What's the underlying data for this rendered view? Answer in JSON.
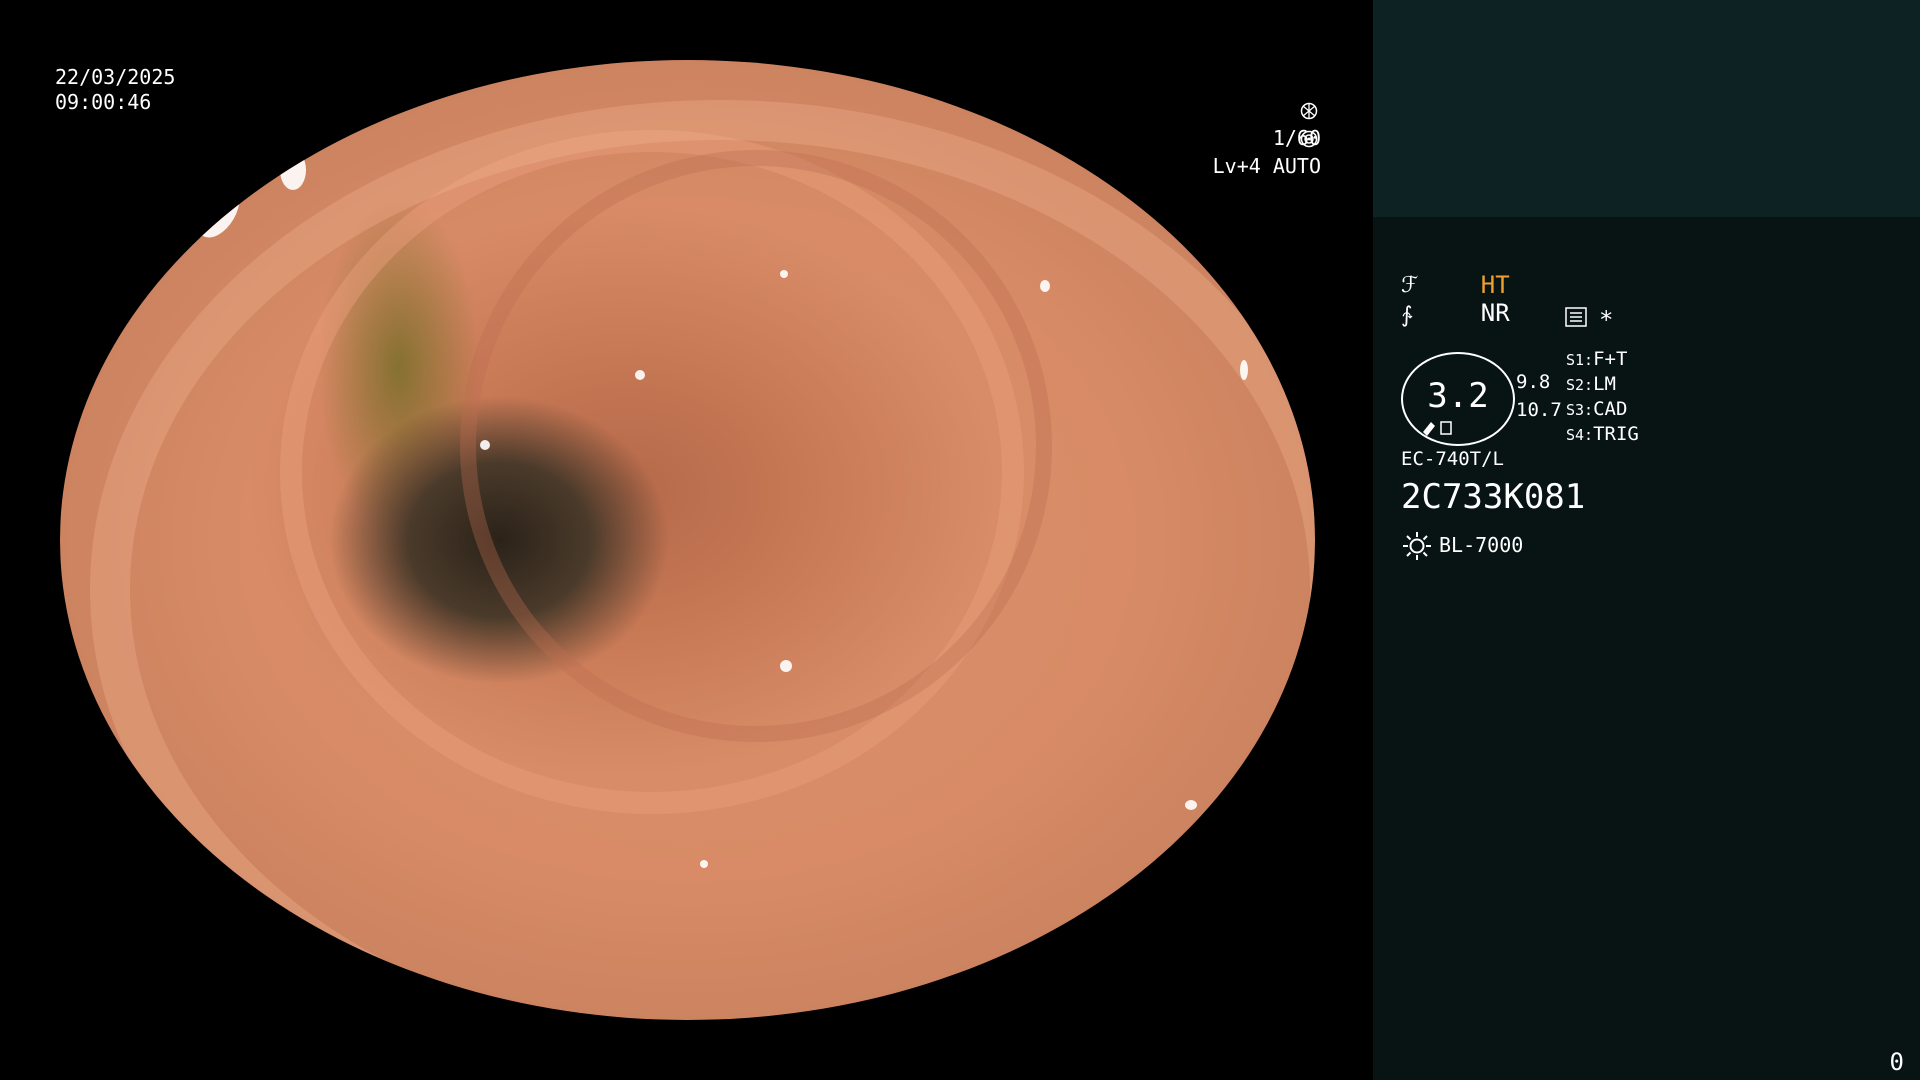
{
  "overlay": {
    "date": "22/03/2025",
    "time": "09:00:46",
    "shutter": "1/60",
    "level": "Lv+4 AUTO"
  },
  "panel": {
    "mode_ht": "HT",
    "mode_nr": "NR",
    "symbol_1": "ℱ",
    "symbol_2": "∱",
    "star": "*",
    "dial_value": "3.2",
    "side_value_1": "9.8",
    "side_value_2": "10.7",
    "switches": [
      {
        "key": "S1:",
        "value": "F+T"
      },
      {
        "key": "S2:",
        "value": "LM"
      },
      {
        "key": "S3:",
        "value": "CAD"
      },
      {
        "key": "S4:",
        "value": "TRIG"
      }
    ],
    "scope_model": "EC-740T/L",
    "serial": "2C733K081",
    "light_source": "BL-7000"
  },
  "counter": "0",
  "icons": {
    "shutter_icon": "aperture-icon",
    "level_icon": "iris-icon",
    "menu_icon": "list-icon",
    "light_icon": "sun-icon"
  }
}
